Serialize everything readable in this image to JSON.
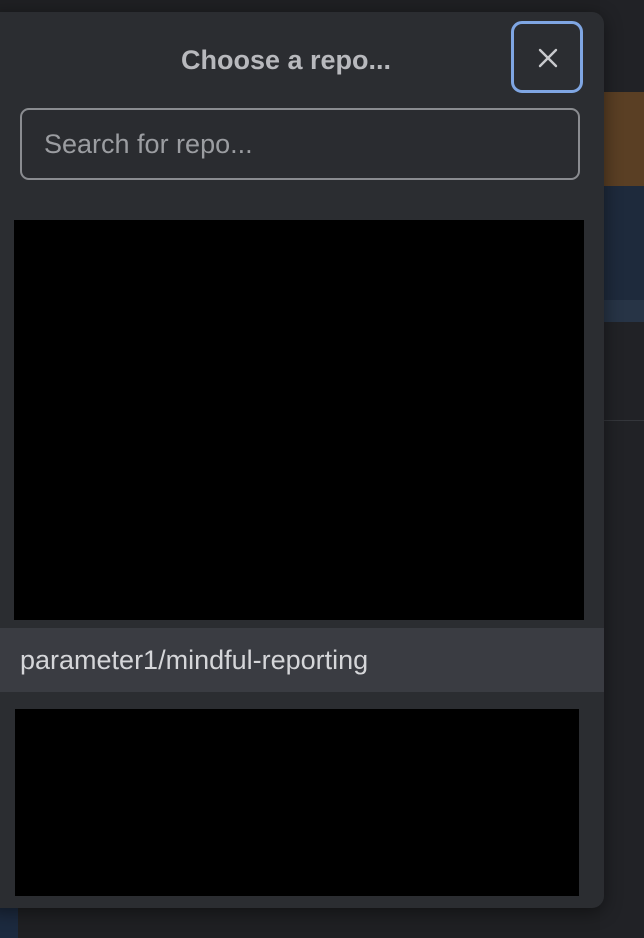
{
  "modal": {
    "title": "Choose a repo...",
    "close_icon": "close-icon",
    "search": {
      "placeholder": "Search for repo...",
      "value": ""
    },
    "items": [
      {
        "label": "parameter1/mindful-reporting",
        "highlighted": true
      }
    ]
  },
  "colors": {
    "modal_bg": "#2b2d31",
    "focus_ring": "#7fa6e3",
    "highlight_row": "#3a3c42",
    "redaction": "#000000"
  }
}
